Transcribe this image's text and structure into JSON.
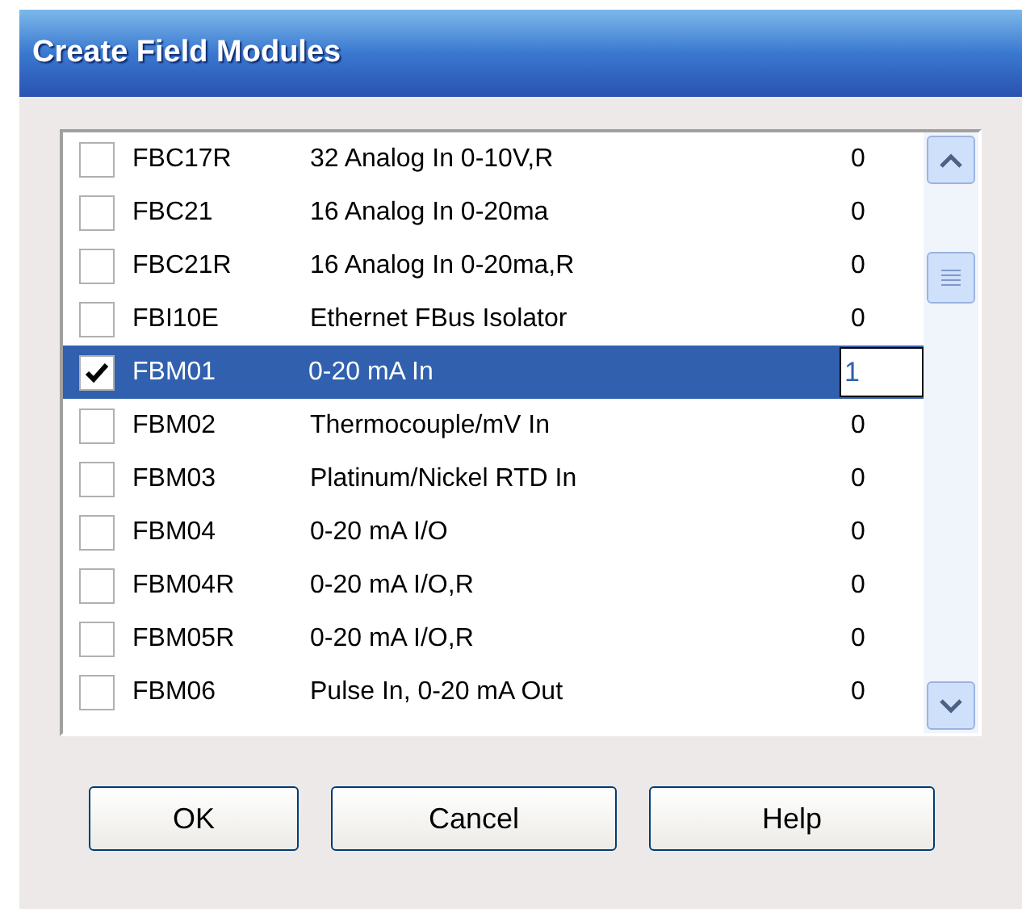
{
  "window": {
    "title": "Create Field Modules"
  },
  "modules": [
    {
      "name": "FBC17R",
      "description": "32 Analog In 0-10V,R",
      "count": "0",
      "checked": false,
      "selected": false
    },
    {
      "name": "FBC21",
      "description": "16 Analog In 0-20ma",
      "count": "0",
      "checked": false,
      "selected": false
    },
    {
      "name": "FBC21R",
      "description": "16 Analog In 0-20ma,R",
      "count": "0",
      "checked": false,
      "selected": false
    },
    {
      "name": "FBI10E",
      "description": "Ethernet FBus Isolator",
      "count": "0",
      "checked": false,
      "selected": false
    },
    {
      "name": "FBM01",
      "description": "0-20 mA In",
      "count": "1",
      "checked": true,
      "selected": true
    },
    {
      "name": "FBM02",
      "description": "Thermocouple/mV In",
      "count": "0",
      "checked": false,
      "selected": false
    },
    {
      "name": "FBM03",
      "description": "Platinum/Nickel RTD In",
      "count": "0",
      "checked": false,
      "selected": false
    },
    {
      "name": "FBM04",
      "description": "0-20 mA I/O",
      "count": "0",
      "checked": false,
      "selected": false
    },
    {
      "name": "FBM04R",
      "description": "0-20 mA I/O,R",
      "count": "0",
      "checked": false,
      "selected": false
    },
    {
      "name": "FBM05R",
      "description": "0-20 mA I/O,R",
      "count": "0",
      "checked": false,
      "selected": false
    },
    {
      "name": "FBM06",
      "description": "Pulse In, 0-20 mA Out",
      "count": "0",
      "checked": false,
      "selected": false
    }
  ],
  "buttons": [
    "OK",
    "Cancel",
    "Help"
  ]
}
